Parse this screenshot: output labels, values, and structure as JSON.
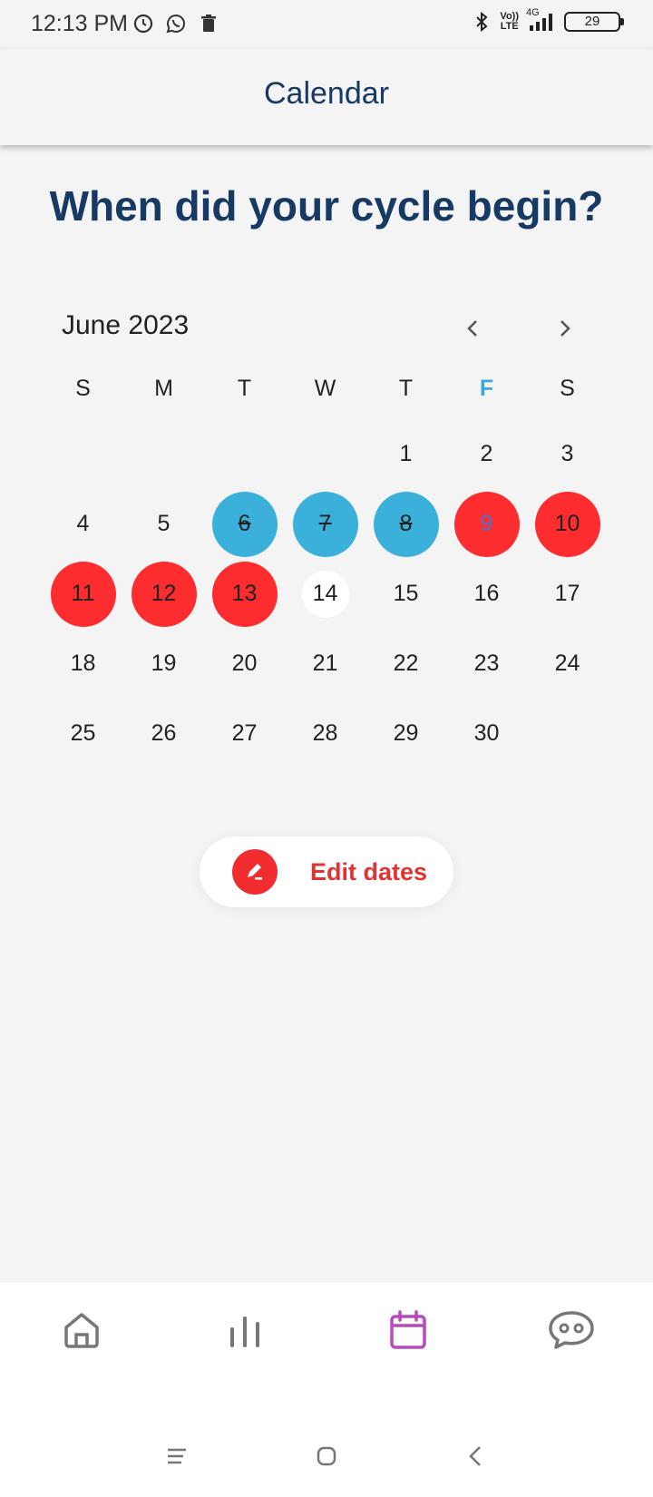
{
  "status_bar": {
    "time": "12:13 PM",
    "left_icons": [
      "alarm-icon",
      "whatsapp-icon",
      "trash-icon"
    ],
    "right_icons": [
      "bluetooth-icon",
      "volte-icon",
      "signal-icon",
      "battery-icon"
    ],
    "volte_line1": "Vo))",
    "volte_line2": "LTE",
    "network": "4G",
    "battery": "29"
  },
  "app_bar": {
    "title": "Calendar"
  },
  "question": "When did your cycle begin?",
  "calendar": {
    "month_label": "June 2023",
    "weekdays": [
      "S",
      "M",
      "T",
      "W",
      "T",
      "F",
      "S"
    ],
    "today_weekday_index": 5,
    "weeks": [
      [
        "",
        "",
        "",
        "",
        "1",
        "2",
        "3"
      ],
      [
        "4",
        "5",
        "6",
        "7",
        "8",
        "9",
        "10"
      ],
      [
        "11",
        "12",
        "13",
        "14",
        "15",
        "16",
        "17"
      ],
      [
        "18",
        "19",
        "20",
        "21",
        "22",
        "23",
        "24"
      ],
      [
        "25",
        "26",
        "27",
        "28",
        "29",
        "30",
        ""
      ]
    ],
    "predicted_days": [
      6,
      7,
      8
    ],
    "period_days": [
      9,
      10,
      11,
      12,
      13
    ],
    "current_day": 14,
    "colors": {
      "predicted": "#3ab0db",
      "period": "#fc2c2f",
      "title": "#173a64",
      "accent": "#3aa7dd"
    }
  },
  "edit_button": {
    "label": "Edit dates",
    "icon": "pencil-icon"
  },
  "tab_bar": {
    "tabs": [
      {
        "name": "home-icon",
        "active": false
      },
      {
        "name": "stats-icon",
        "active": false
      },
      {
        "name": "calendar-icon",
        "active": true
      },
      {
        "name": "chat-icon",
        "active": false
      }
    ],
    "active_color": "#b84bbb",
    "inactive_color": "#777777"
  },
  "system_nav": [
    "menu-icon",
    "home-square-icon",
    "back-icon"
  ]
}
